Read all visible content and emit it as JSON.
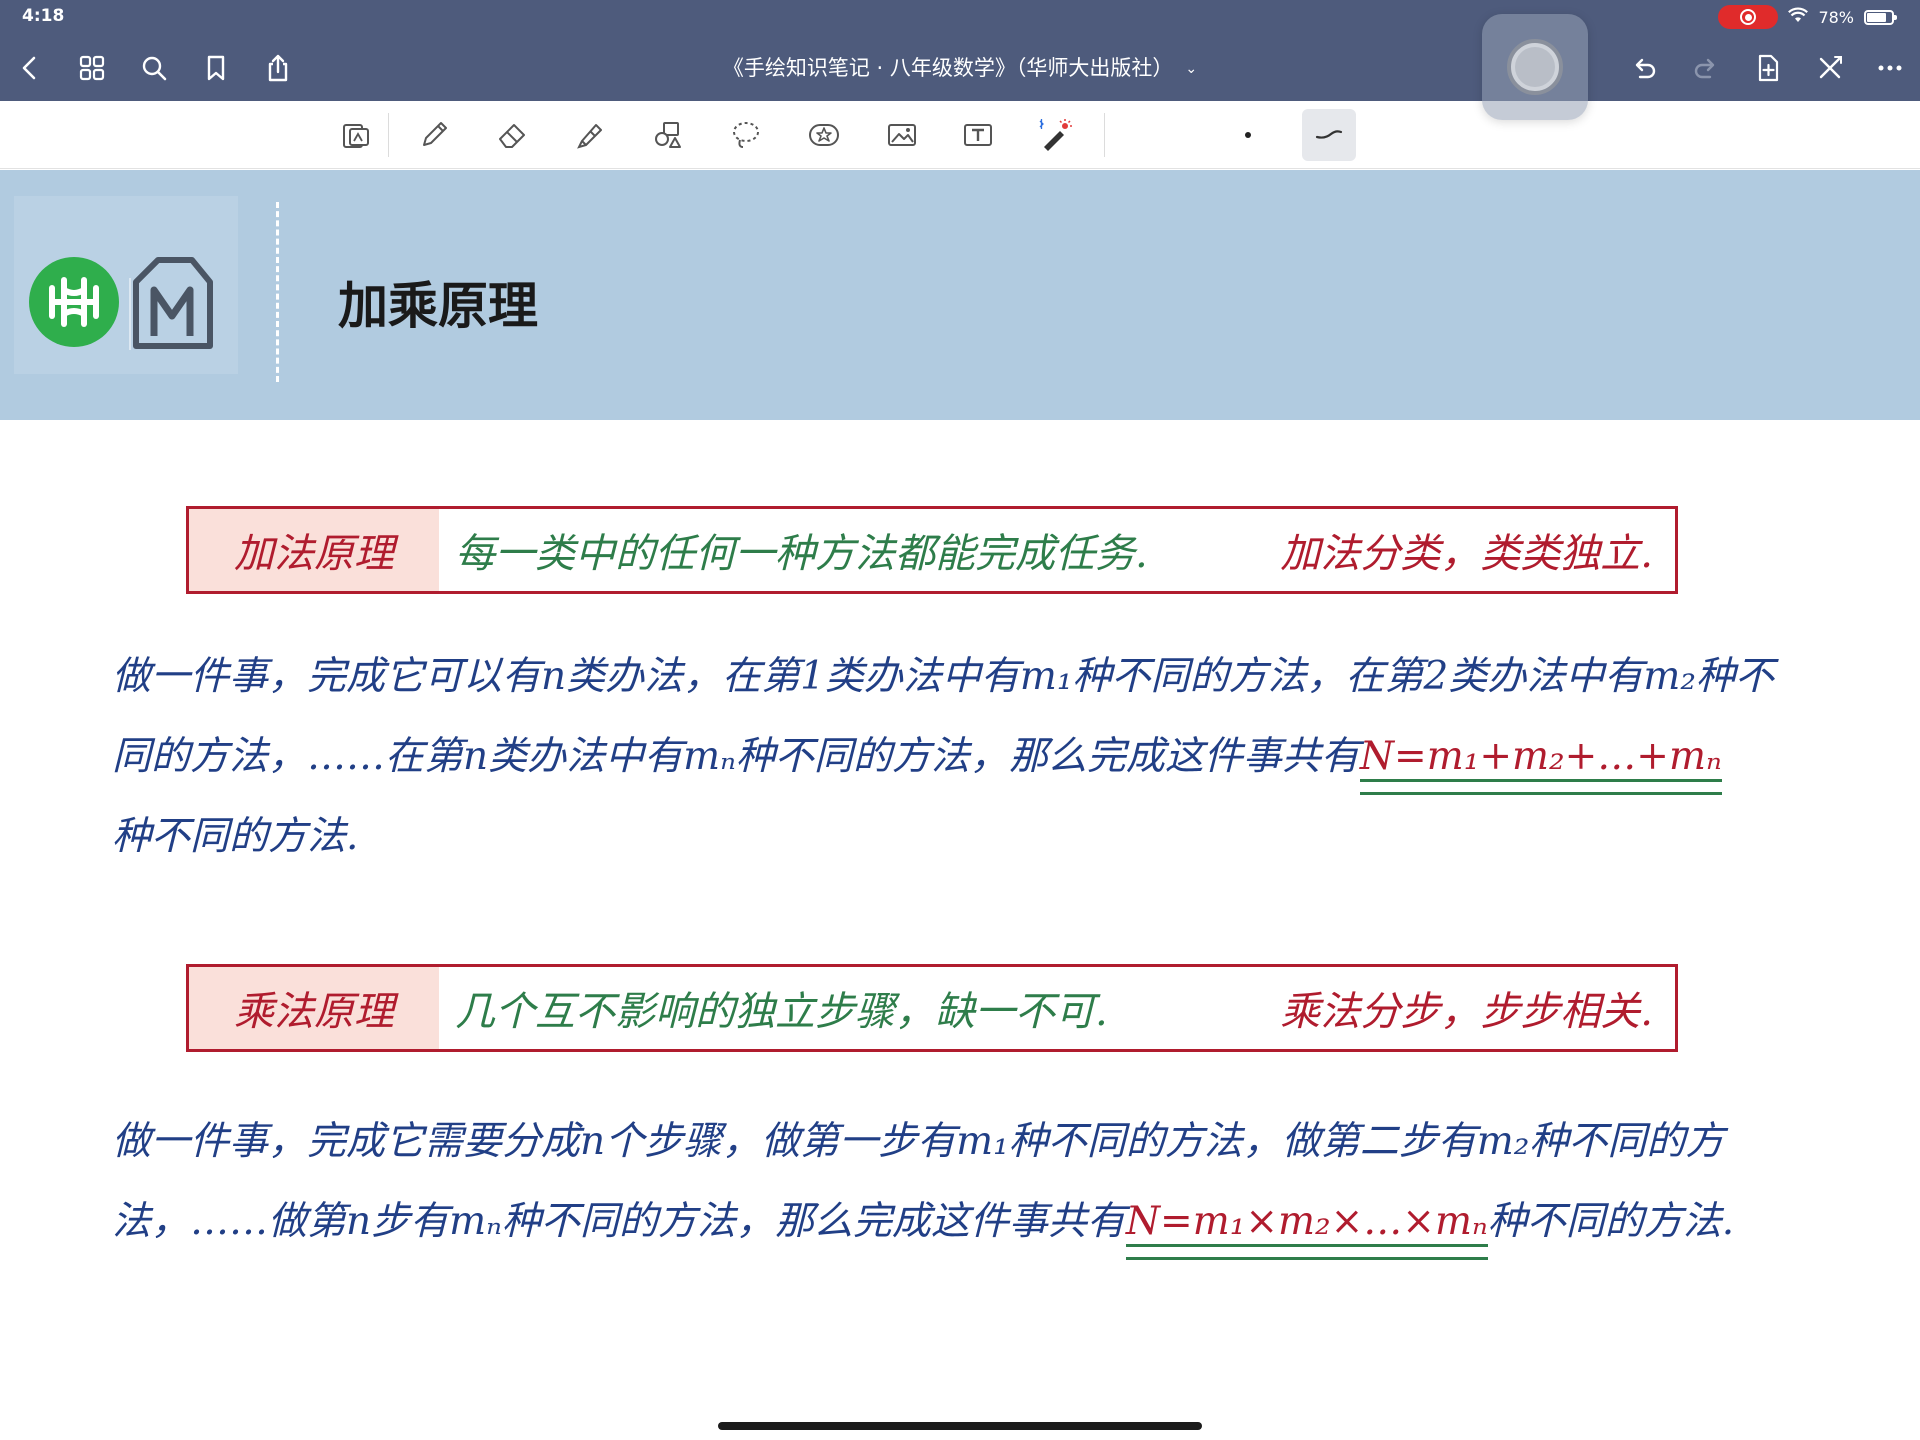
{
  "status_bar": {
    "time": "4:18",
    "battery_text": "78%",
    "battery_level": 0.78
  },
  "nav_bar": {
    "title": "《手绘知识笔记 · 八年级数学》（华师大出版社）",
    "title_caret": "⌄"
  },
  "page": {
    "title": "加乘原理"
  },
  "addition": {
    "label": "加法原理",
    "definition": "每一类中的任何一种方法都能完成任务.",
    "motto": "加法分类，类类独立.",
    "paragraph_text": "做一件事，完成它可以有n类办法，在第1类办法中有m₁种不同的方法，在第2类办法中有m₂种不同的方法，……在第n类办法中有mₙ种不同的方法，那么完成这件事共有",
    "formula": "N=m₁+m₂+…+mₙ",
    "paragraph_end": "种不同的方法."
  },
  "multiplication": {
    "label": "乘法原理",
    "definition": "几个互不影响的独立步骤，缺一不可.",
    "motto": "乘法分步，步步相关.",
    "paragraph_text": "做一件事，完成它需要分成n个步骤，做第一步有m₁种不同的方法，做第二步有m₂种不同的方法，……做第n步有mₙ种不同的方法，那么完成这件事共有",
    "formula": "N=m₁×m₂×…×mₙ",
    "paragraph_end": "种不同的方法."
  },
  "colors": {
    "nav_bg": "#4e5b7c",
    "header_bg": "#b1cbe0",
    "accent_red": "#b01c2e",
    "ink_blue": "#213f86",
    "ink_green": "#2e7d4a"
  }
}
